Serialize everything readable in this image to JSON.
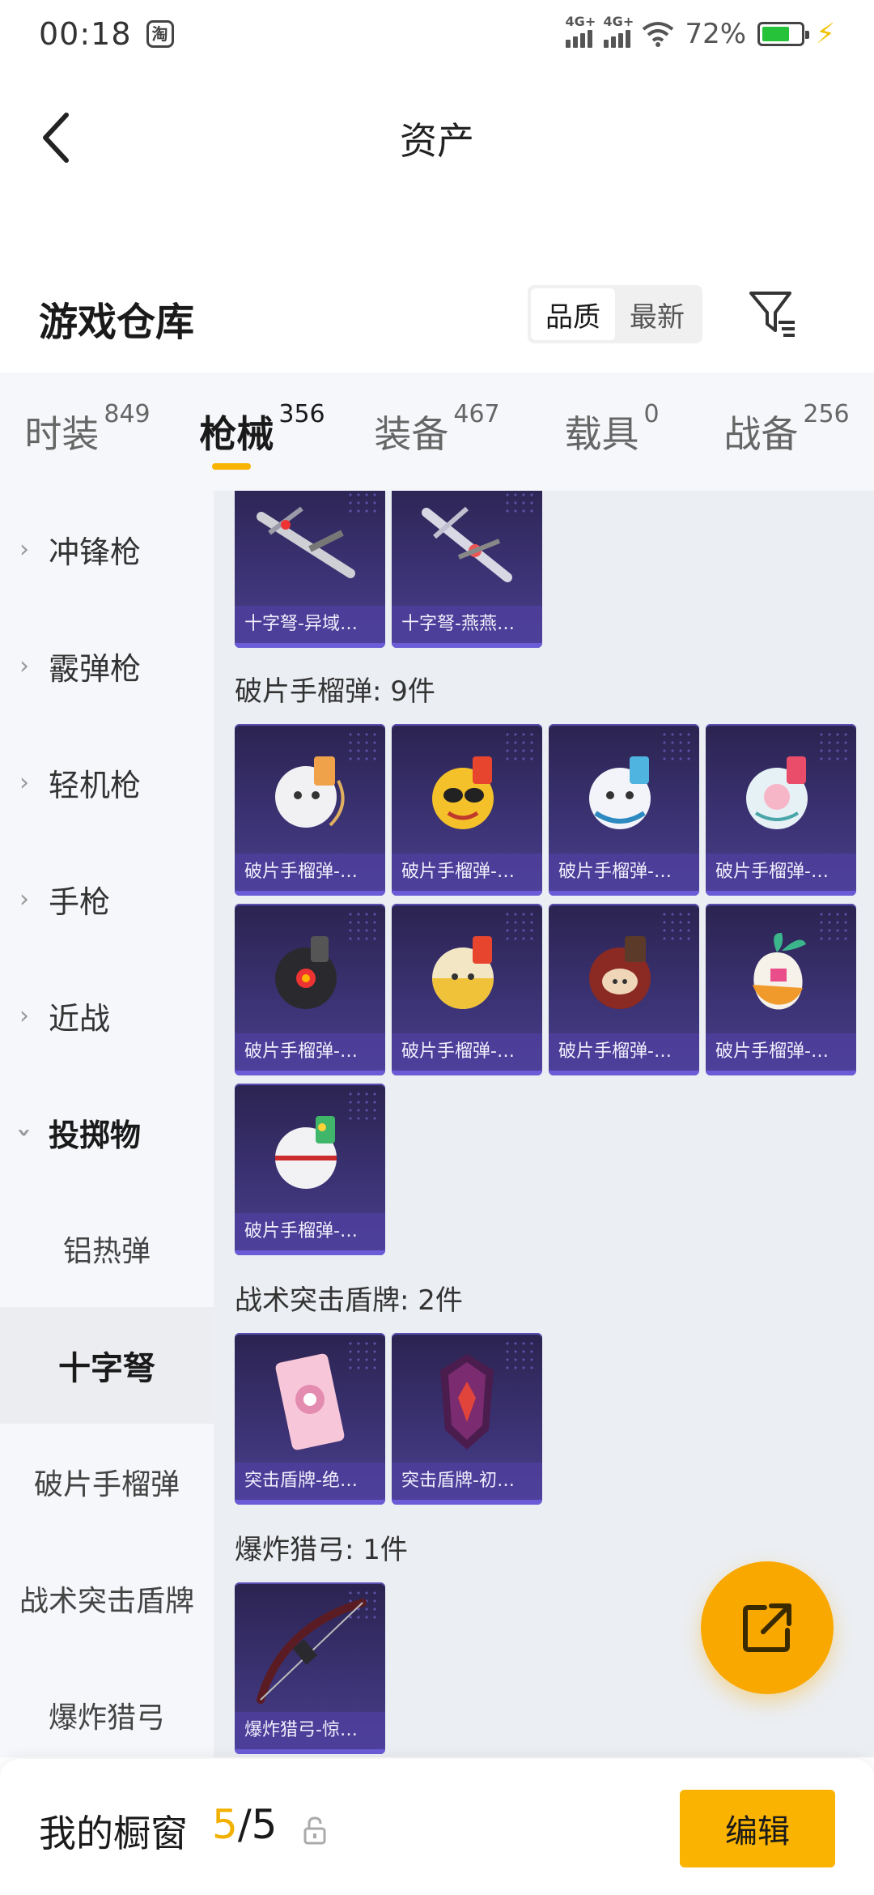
{
  "status_bar": {
    "time": "00:18",
    "app_badge": "淘",
    "network1": "4G+",
    "network2": "4G+",
    "battery_percent": "72%",
    "battery_level": 0.72
  },
  "header": {
    "title": "资产"
  },
  "warehouse": {
    "title": "游戏仓库",
    "sort_options": [
      "品质",
      "最新"
    ],
    "active_sort": "品质"
  },
  "category_tabs": [
    {
      "label": "时装",
      "count": "849"
    },
    {
      "label": "枪械",
      "count": "356",
      "active": true
    },
    {
      "label": "装备",
      "count": "467"
    },
    {
      "label": "载具",
      "count": "0"
    },
    {
      "label": "战备",
      "count": "256"
    }
  ],
  "sidebar": {
    "parents": [
      "冲锋枪",
      "霰弹枪",
      "轻机枪",
      "手枪",
      "近战",
      "投掷物"
    ],
    "subs": [
      "铝热弹",
      "十字弩",
      "破片手榴弹",
      "战术突击盾牌",
      "爆炸猎弓"
    ],
    "active_sub": "十字弩"
  },
  "sections": {
    "crossbow": {
      "items": [
        "十字弩-异域…",
        "十字弩-燕燕…"
      ]
    },
    "grenade": {
      "title": "破片手榴弹: 9件",
      "items": [
        "破片手榴弹-…",
        "破片手榴弹-…",
        "破片手榴弹-…",
        "破片手榴弹-…",
        "破片手榴弹-…",
        "破片手榴弹-…",
        "破片手榴弹-…",
        "破片手榴弹-…",
        "破片手榴弹-…"
      ]
    },
    "shield": {
      "title": "战术突击盾牌: 2件",
      "items": [
        "突击盾牌-绝…",
        "突击盾牌-初…"
      ]
    },
    "bow": {
      "title": "爆炸猎弓: 1件",
      "items": [
        "爆炸猎弓-惊…"
      ]
    }
  },
  "bottom_bar": {
    "label": "我的橱窗",
    "current": "5",
    "separator": "/",
    "total": "5",
    "edit_label": "编辑"
  },
  "colors": {
    "accent": "#f9b300",
    "card_bg": "#3b3273",
    "sidebar_bg": "#f5f7fa",
    "content_bg": "#ebeef2"
  }
}
